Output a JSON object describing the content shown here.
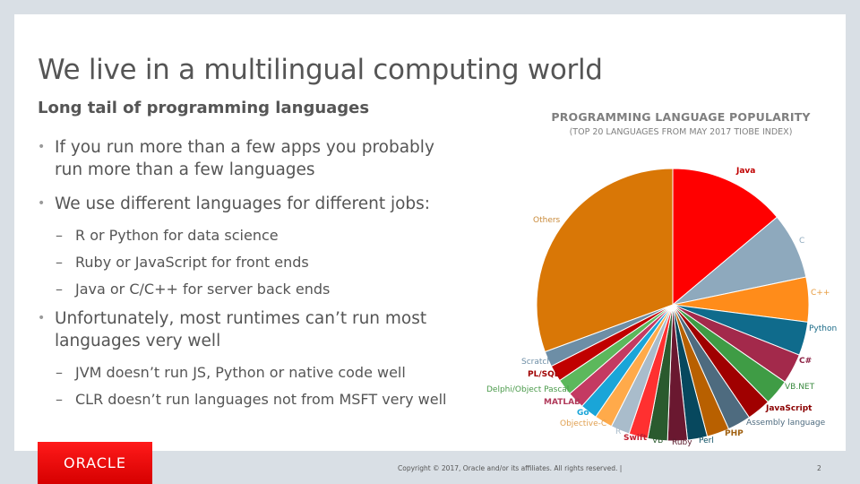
{
  "slide": {
    "title": "We live in a multilingual computing world",
    "subtitle": "Long tail of programming languages",
    "bullets": [
      {
        "text": "If you run more than a few apps you probably run more than a few languages",
        "sub": []
      },
      {
        "text": "We use different languages for different jobs:",
        "sub": [
          "R or Python for data science",
          "Ruby or JavaScript for front ends",
          "Java or C/C++ for server back ends"
        ]
      },
      {
        "text": "Unfortunately, most runtimes can’t run most languages very well",
        "sub": [
          "JVM doesn’t run JS, Python or native code well",
          "CLR doesn’t run languages not from MSFT very well"
        ]
      }
    ],
    "bullet_glyph": "•",
    "dash_glyph": "–"
  },
  "footer": {
    "logo_text": "ORACLE",
    "logo_mark": "®",
    "copyright": "Copyright © 2017, Oracle and/or its affiliates. All rights reserved.  |",
    "page_number": "2"
  },
  "chart_data": {
    "type": "pie",
    "title": "PROGRAMMING LANGUAGE POPULARITY",
    "subtitle": "(TOP 20 LANGUAGES FROM MAY 2017 TIOBE INDEX)",
    "start_angle": "12 o'clock, clockwise",
    "unit": "percent",
    "slices": [
      {
        "label": "Java",
        "value": 13.6,
        "color": "#ff0000",
        "label_color": "#c00000"
      },
      {
        "label": "C",
        "value": 7.7,
        "color": "#8ea9bd",
        "label_color": "#8ea9bd"
      },
      {
        "label": "C++",
        "value": 5.2,
        "color": "#ff8c1a",
        "label_color": "#e69a3c"
      },
      {
        "label": "Python",
        "value": 3.9,
        "color": "#0f6b8c",
        "label_color": "#1a6a87"
      },
      {
        "label": "C#",
        "value": 3.5,
        "color": "#a3294b",
        "label_color": "#8c2244"
      },
      {
        "label": "VB.NET",
        "value": 3.0,
        "color": "#3f9c45",
        "label_color": "#3a8a3f"
      },
      {
        "label": "JavaScript",
        "value": 2.8,
        "color": "#a00000",
        "label_color": "#8b0000"
      },
      {
        "label": "Assembly language",
        "value": 2.7,
        "color": "#4e6b7f",
        "label_color": "#4e6b7f"
      },
      {
        "label": "PHP",
        "value": 2.6,
        "color": "#b86000",
        "label_color": "#a06010"
      },
      {
        "label": "Perl",
        "value": 2.3,
        "color": "#07485e",
        "label_color": "#0b4f63"
      },
      {
        "label": "Ruby",
        "value": 2.3,
        "color": "#6a1830",
        "label_color": "#5a1a2c"
      },
      {
        "label": "VB",
        "value": 2.3,
        "color": "#2a5a2e",
        "label_color": "#2a5a2e"
      },
      {
        "label": "Swift",
        "value": 2.2,
        "color": "#ff3030",
        "label_color": "#c02030"
      },
      {
        "label": "R",
        "value": 2.2,
        "color": "#a9bccb",
        "label_color": "#a9bccb"
      },
      {
        "label": "Objective-C",
        "value": 2.1,
        "color": "#ffaa4a",
        "label_color": "#e0a050"
      },
      {
        "label": "Go",
        "value": 2.0,
        "color": "#1aa5d8",
        "label_color": "#1aa5d8"
      },
      {
        "label": "MATLAB",
        "value": 2.0,
        "color": "#c43a62",
        "label_color": "#b03a5a"
      },
      {
        "label": "Delphi/Object Pascal",
        "value": 1.9,
        "color": "#5cb85c",
        "label_color": "#4a9a4a"
      },
      {
        "label": "PL/SQL",
        "value": 1.9,
        "color": "#c00000",
        "label_color": "#a00000"
      },
      {
        "label": "Scratch",
        "value": 1.8,
        "color": "#6d8ea6",
        "label_color": "#6d8ea6"
      },
      {
        "label": "Others",
        "value": 30.0,
        "color": "#d97706",
        "label_color": "#c98a3a"
      }
    ]
  }
}
